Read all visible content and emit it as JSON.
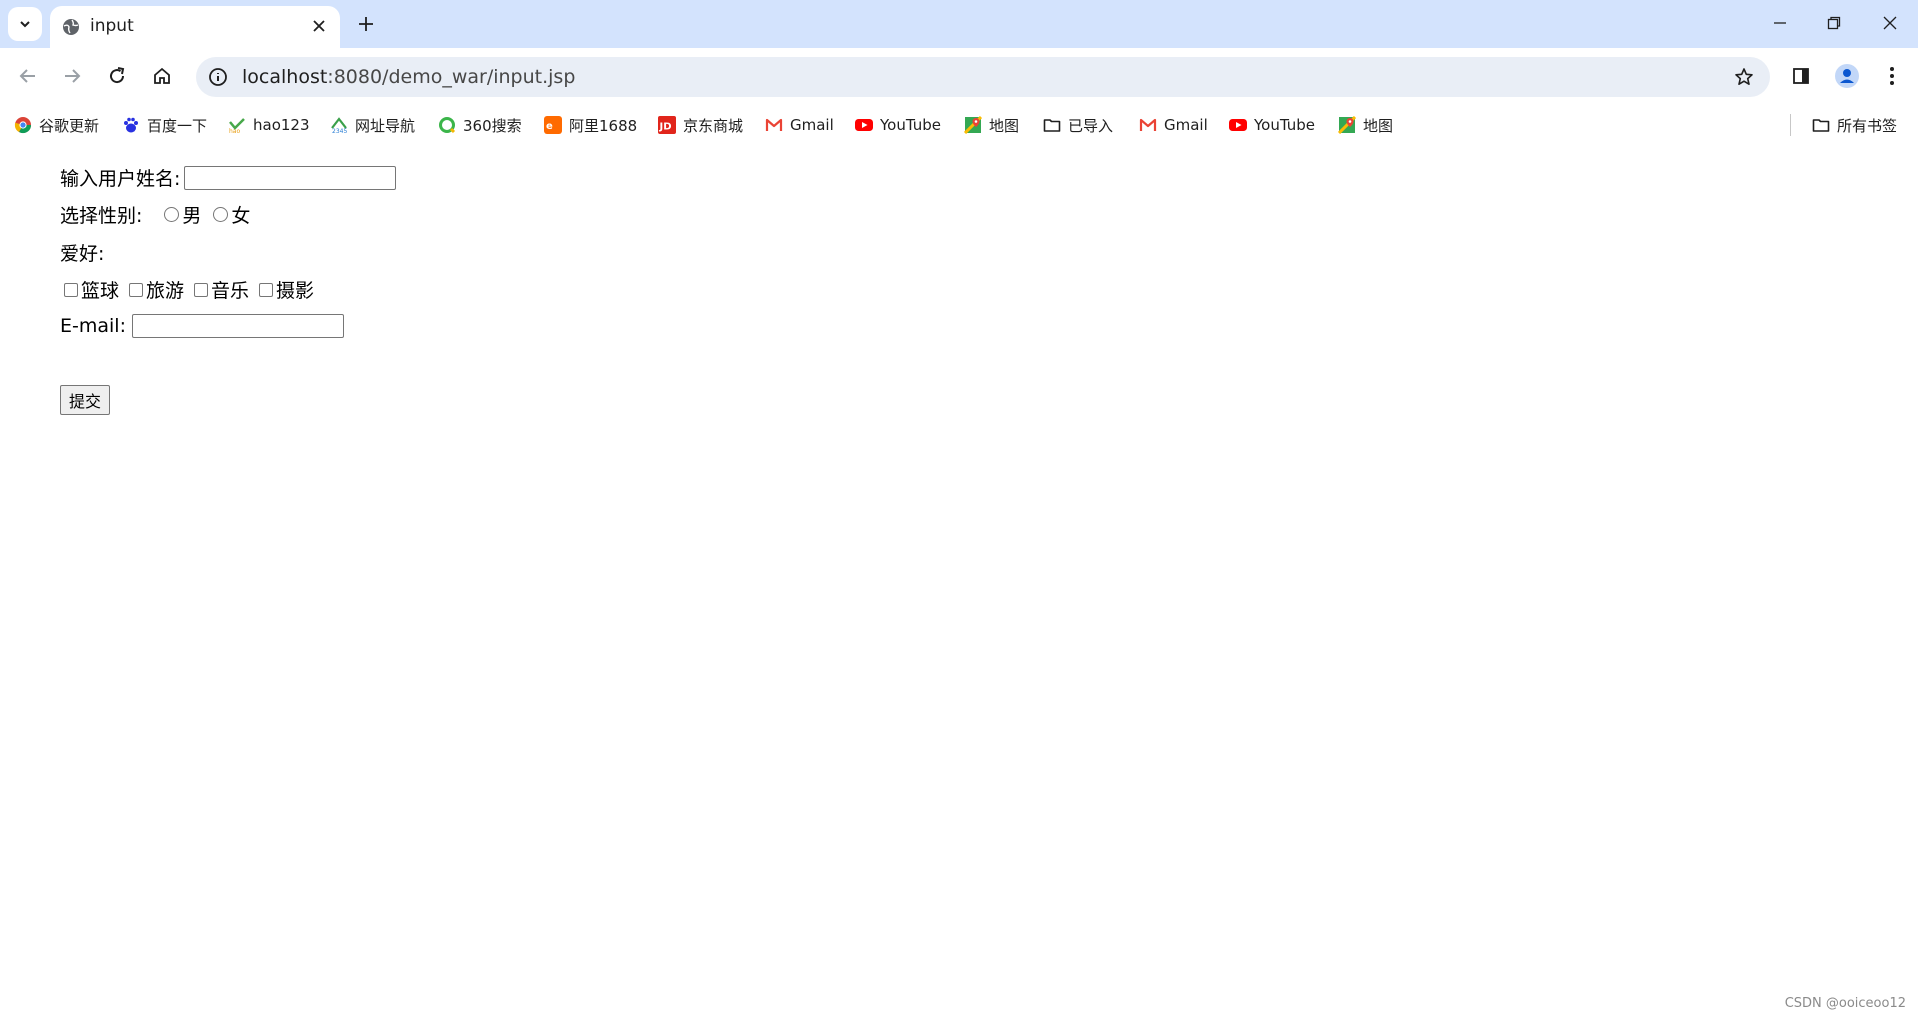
{
  "browser": {
    "tab": {
      "title": "input"
    },
    "address": {
      "host": "localhost",
      "path": ":8080/demo_war/input.jsp"
    },
    "bookmarks": [
      {
        "label": "谷歌更新",
        "icon": "chrome-icon"
      },
      {
        "label": "百度一下",
        "icon": "baidu-icon"
      },
      {
        "label": "hao123",
        "icon": "hao123-icon"
      },
      {
        "label": "网址导航",
        "icon": "2345-icon"
      },
      {
        "label": "360搜索",
        "icon": "360-icon"
      },
      {
        "label": "阿里1688",
        "icon": "1688-icon"
      },
      {
        "label": "京东商城",
        "icon": "jd-icon"
      },
      {
        "label": "Gmail",
        "icon": "gmail-icon"
      },
      {
        "label": "YouTube",
        "icon": "youtube-icon"
      },
      {
        "label": "地图",
        "icon": "maps-icon"
      },
      {
        "label": "已导入",
        "icon": "folder-icon"
      },
      {
        "label": "Gmail",
        "icon": "gmail-icon"
      },
      {
        "label": "YouTube",
        "icon": "youtube-icon"
      },
      {
        "label": "地图",
        "icon": "maps-icon"
      }
    ],
    "all_bookmarks_label": "所有书签"
  },
  "form": {
    "username_label": "输入用户姓名:",
    "username_value": "",
    "gender_label": "选择性别:",
    "gender_options": [
      "男",
      "女"
    ],
    "hobby_label": "爱好:",
    "hobbies": [
      "篮球",
      "旅游",
      "音乐",
      "摄影"
    ],
    "email_label": "E-mail:",
    "email_value": "",
    "submit_label": "提交"
  },
  "watermark": "CSDN @ooiceoo12"
}
